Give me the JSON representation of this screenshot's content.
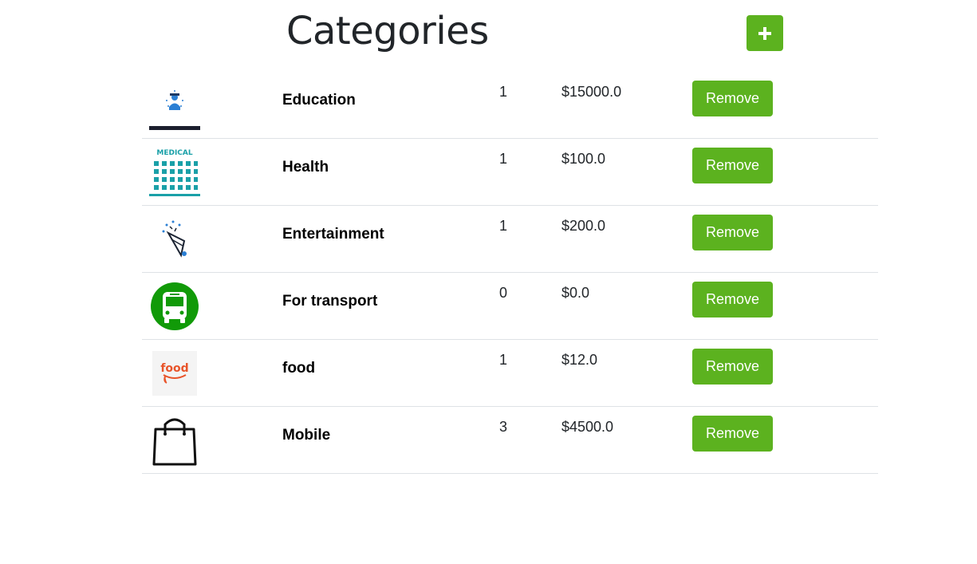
{
  "page": {
    "title": "Categories",
    "add_icon": "plus-icon"
  },
  "categories": [
    {
      "name": "Education",
      "count": "1",
      "total": "$15000.0",
      "remove_label": "Remove",
      "icon": "education-image"
    },
    {
      "name": "Health",
      "count": "1",
      "total": "$100.0",
      "remove_label": "Remove",
      "icon": "medical-image"
    },
    {
      "name": "Entertainment",
      "count": "1",
      "total": "$200.0",
      "remove_label": "Remove",
      "icon": "party-popper-image"
    },
    {
      "name": "For transport",
      "count": "0",
      "total": "$0.0",
      "remove_label": "Remove",
      "icon": "bus-image"
    },
    {
      "name": "food",
      "count": "1",
      "total": "$12.0",
      "remove_label": "Remove",
      "icon": "food-logo-image"
    },
    {
      "name": "Mobile",
      "count": "3",
      "total": "$4500.0",
      "remove_label": "Remove",
      "icon": "shopping-bag-image"
    }
  ],
  "colors": {
    "accent": "#5cb21f",
    "divider": "#dee2e6",
    "text": "#212529"
  },
  "thumb_text": {
    "medical": "MEDICAL",
    "food": "food"
  }
}
